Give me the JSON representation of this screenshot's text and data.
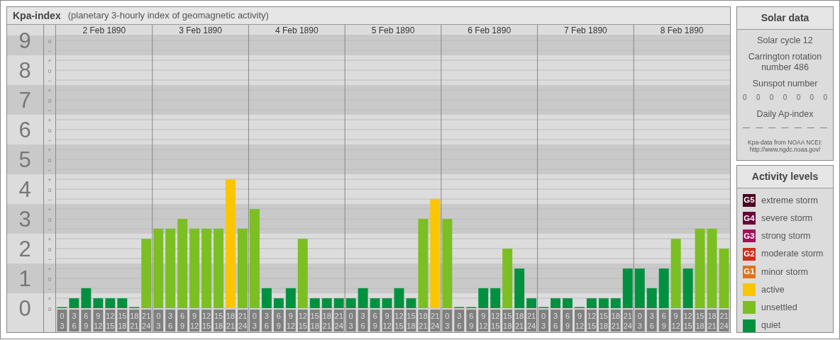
{
  "kp_panel": {
    "title": "Kpa-index",
    "subtitle": "(planetary 3-hourly index of geomagnetic activity)",
    "chart_data": {
      "type": "bar",
      "ylim": [
        0,
        9
      ],
      "yticks": [
        0,
        1,
        2,
        3,
        4,
        5,
        6,
        7,
        8,
        9
      ],
      "series": [
        {
          "color": "#009140",
          "values": [
            0,
            0.33,
            0.67,
            0.33,
            0.33,
            0.33,
            0,
            null,
            null,
            null,
            null,
            null,
            null,
            null,
            null,
            null,
            null,
            0.67,
            0.33,
            0.67,
            null,
            0.33,
            0.33,
            0.33,
            0.33,
            0.67,
            0.33,
            0.33,
            0.67,
            0.33,
            null,
            null,
            null,
            0,
            0,
            0.67,
            0.67,
            null,
            1.33,
            0.33,
            0,
            0.33,
            0.33,
            0,
            0.33,
            0.33,
            0.33,
            1.33,
            1.33,
            0.67,
            1.33,
            null,
            1.33,
            null,
            null,
            null
          ]
        },
        {
          "color": "#7bbf22",
          "values": [
            null,
            null,
            null,
            null,
            null,
            null,
            null,
            2.33,
            2.67,
            2.67,
            3,
            2.67,
            2.67,
            2.67,
            null,
            2.67,
            3.33,
            null,
            null,
            null,
            2.33,
            null,
            null,
            null,
            null,
            null,
            null,
            null,
            null,
            null,
            3,
            null,
            3,
            null,
            null,
            null,
            null,
            2,
            null,
            null,
            null,
            null,
            null,
            null,
            null,
            null,
            null,
            null,
            null,
            null,
            null,
            2.33,
            null,
            2.67,
            2.67,
            2
          ]
        },
        {
          "color": "#f9c600",
          "values": [
            null,
            null,
            null,
            null,
            null,
            null,
            null,
            null,
            null,
            null,
            null,
            null,
            null,
            null,
            4.33,
            null,
            null,
            null,
            null,
            null,
            null,
            null,
            null,
            null,
            null,
            null,
            null,
            null,
            null,
            null,
            null,
            3.67,
            null,
            null,
            null,
            null,
            null,
            null,
            null,
            null,
            null,
            null,
            null,
            null,
            null,
            null,
            null,
            null,
            null,
            null,
            null,
            null,
            null,
            null,
            null,
            null
          ]
        }
      ],
      "grid": true
    },
    "sub_ticks": [
      "o",
      "−",
      "+",
      "o",
      "−",
      "+",
      "o",
      "−",
      "+",
      "o",
      "−",
      "+",
      "o",
      "−",
      "+",
      "o",
      "−",
      "+",
      "o",
      "−",
      "+",
      "o",
      "−",
      "+",
      "o",
      "−",
      "+",
      "o"
    ],
    "days": [
      {
        "date": "2 Feb 1890",
        "time_slots": [
          {
            "start": "0",
            "end": "3"
          },
          {
            "start": "3",
            "end": "6"
          },
          {
            "start": "6",
            "end": "9"
          },
          {
            "start": "9",
            "end": "12"
          },
          {
            "start": "12",
            "end": "15"
          },
          {
            "start": "15",
            "end": "18"
          },
          {
            "start": "18",
            "end": "21"
          },
          {
            "start": "21",
            "end": "24"
          }
        ]
      },
      {
        "date": "3 Feb 1890",
        "time_slots": [
          {
            "start": "0",
            "end": "3"
          },
          {
            "start": "3",
            "end": "6"
          },
          {
            "start": "6",
            "end": "9"
          },
          {
            "start": "9",
            "end": "12"
          },
          {
            "start": "12",
            "end": "15"
          },
          {
            "start": "15",
            "end": "18"
          },
          {
            "start": "18",
            "end": "21"
          },
          {
            "start": "21",
            "end": "24"
          }
        ]
      },
      {
        "date": "4 Feb 1890",
        "time_slots": [
          {
            "start": "0",
            "end": "3"
          },
          {
            "start": "3",
            "end": "6"
          },
          {
            "start": "6",
            "end": "9"
          },
          {
            "start": "9",
            "end": "12"
          },
          {
            "start": "12",
            "end": "15"
          },
          {
            "start": "15",
            "end": "18"
          },
          {
            "start": "18",
            "end": "21"
          },
          {
            "start": "21",
            "end": "24"
          }
        ]
      },
      {
        "date": "5 Feb 1890",
        "time_slots": [
          {
            "start": "0",
            "end": "3"
          },
          {
            "start": "3",
            "end": "6"
          },
          {
            "start": "6",
            "end": "9"
          },
          {
            "start": "9",
            "end": "12"
          },
          {
            "start": "12",
            "end": "15"
          },
          {
            "start": "15",
            "end": "18"
          },
          {
            "start": "18",
            "end": "21"
          },
          {
            "start": "21",
            "end": "24"
          }
        ]
      },
      {
        "date": "6 Feb 1890",
        "time_slots": [
          {
            "start": "0",
            "end": "3"
          },
          {
            "start": "3",
            "end": "6"
          },
          {
            "start": "6",
            "end": "9"
          },
          {
            "start": "9",
            "end": "12"
          },
          {
            "start": "12",
            "end": "15"
          },
          {
            "start": "15",
            "end": "18"
          },
          {
            "start": "18",
            "end": "21"
          },
          {
            "start": "21",
            "end": "24"
          }
        ]
      },
      {
        "date": "7 Feb 1890",
        "time_slots": [
          {
            "start": "0",
            "end": "3"
          },
          {
            "start": "3",
            "end": "6"
          },
          {
            "start": "6",
            "end": "9"
          },
          {
            "start": "9",
            "end": "12"
          },
          {
            "start": "12",
            "end": "15"
          },
          {
            "start": "15",
            "end": "18"
          },
          {
            "start": "18",
            "end": "21"
          },
          {
            "start": "21",
            "end": "24"
          }
        ]
      },
      {
        "date": "8 Feb 1890",
        "time_slots": [
          {
            "start": "0",
            "end": "3"
          },
          {
            "start": "3",
            "end": "6"
          },
          {
            "start": "6",
            "end": "9"
          },
          {
            "start": "9",
            "end": "12"
          },
          {
            "start": "12",
            "end": "15"
          },
          {
            "start": "15",
            "end": "18"
          },
          {
            "start": "18",
            "end": "21"
          },
          {
            "start": "21",
            "end": "24"
          }
        ]
      }
    ]
  },
  "solar_data": {
    "title": "Solar data",
    "solar_cycle": "Solar cycle 12",
    "carrington": "Carrington rotation number 486",
    "sunspot_label": "Sunspot number",
    "sunspot_numbers": [
      "0",
      "0",
      "0",
      "0",
      "0",
      "0",
      "0"
    ],
    "ap_label": "Daily Ap-index",
    "ap_values": [
      "—",
      "—",
      "—",
      "—",
      "—",
      "—",
      "—"
    ],
    "source": "Kpa-data from NOAA NCEI: http://www.ngdc.noaa.gov/"
  },
  "legend": {
    "title": "Activity levels",
    "items": [
      {
        "kind": "storm",
        "code": "G5",
        "label": "extreme storm",
        "color": "#4a0020"
      },
      {
        "kind": "storm",
        "code": "G4",
        "label": "severe storm",
        "color": "#6a0038"
      },
      {
        "kind": "storm",
        "code": "G3",
        "label": "strong storm",
        "color": "#a3105c"
      },
      {
        "kind": "storm",
        "code": "G2",
        "label": "moderate storm",
        "color": "#d42a1a"
      },
      {
        "kind": "storm",
        "code": "G1",
        "label": "minor storm",
        "color": "#e0721a"
      },
      {
        "kind": "level",
        "label": "active",
        "color": "#f9c600"
      },
      {
        "kind": "level",
        "label": "unsettled",
        "color": "#7bbf22"
      },
      {
        "kind": "level",
        "label": "quiet",
        "color": "#009140"
      }
    ]
  }
}
